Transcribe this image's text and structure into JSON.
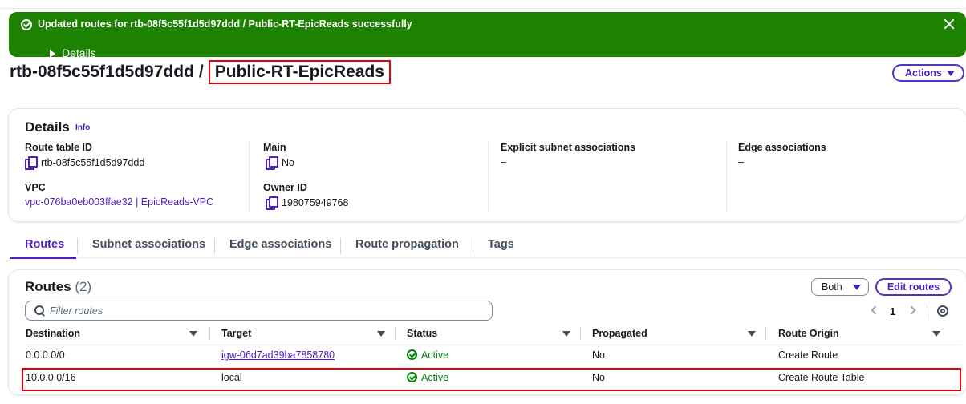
{
  "flash": {
    "message": "Updated routes for rtb-08f5c55f1d5d97ddd / Public-RT-EpicReads successfully",
    "details_label": "Details",
    "color": "#1d8102"
  },
  "header": {
    "route_table_id": "rtb-08f5c55f1d5d97ddd",
    "separator": "/",
    "name": "Public-RT-EpicReads",
    "actions_label": "Actions"
  },
  "details": {
    "title": "Details",
    "info_label": "Info",
    "route_table_id_label": "Route table ID",
    "route_table_id": "rtb-08f5c55f1d5d97ddd",
    "main_label": "Main",
    "main_value": "No",
    "explicit_label": "Explicit subnet associations",
    "explicit_value": "–",
    "edge_label": "Edge associations",
    "edge_value": "–",
    "vpc_label": "VPC",
    "vpc_value": "vpc-076ba0eb003ffae32 | EpicReads-VPC",
    "owner_label": "Owner ID",
    "owner_value": "198075949768"
  },
  "tabs": [
    {
      "label": "Routes",
      "active": true
    },
    {
      "label": "Subnet associations",
      "active": false
    },
    {
      "label": "Edge associations",
      "active": false
    },
    {
      "label": "Route propagation",
      "active": false
    },
    {
      "label": "Tags",
      "active": false
    }
  ],
  "routes": {
    "title": "Routes",
    "count": "(2)",
    "filter_select": "Both",
    "edit_label": "Edit routes",
    "filter_placeholder": "Filter routes",
    "page": "1",
    "columns": [
      "Destination",
      "Target",
      "Status",
      "Propagated",
      "Route Origin"
    ],
    "rows": [
      {
        "destination": "0.0.0.0/0",
        "target": "igw-06d7ad39ba7858780",
        "status": "Active",
        "propagated": "No",
        "origin": "Create Route"
      },
      {
        "destination": "10.0.0.0/16",
        "target": "local",
        "status": "Active",
        "propagated": "No",
        "origin": "Create Route Table"
      }
    ]
  },
  "colors": {
    "accent": "#4b1fbf",
    "success": "#037f0c",
    "highlight": "#e3000b"
  }
}
